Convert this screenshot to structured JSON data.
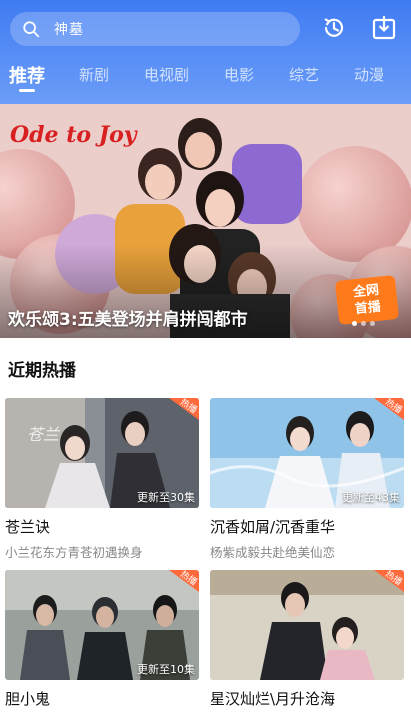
{
  "search": {
    "text": "神墓"
  },
  "tabs": [
    {
      "label": "推荐",
      "active": true
    },
    {
      "label": "新剧"
    },
    {
      "label": "电视剧"
    },
    {
      "label": "电影"
    },
    {
      "label": "综艺"
    },
    {
      "label": "动漫"
    }
  ],
  "header_icons": [
    "history-icon",
    "download-icon"
  ],
  "banner": {
    "logo_text": "Ode to Joy",
    "caption": "欢乐颂3:五美登场并肩拼闯都市",
    "badge_line1": "全网",
    "badge_line2": "首播"
  },
  "section": {
    "title": "近期热播"
  },
  "cards": [
    {
      "title": "苍兰诀",
      "subtitle": "小兰花东方青苍初遇换身",
      "update": "更新至30集",
      "hot": "热播"
    },
    {
      "title": "沉香如屑/沉香重华",
      "subtitle": "杨紫成毅共赴绝美仙恋",
      "update": "更新至43集",
      "hot": "热播"
    },
    {
      "title": "胆小鬼",
      "subtitle": "",
      "update": "更新至10集",
      "hot": "热播"
    },
    {
      "title": "星汉灿烂\\月升沧海",
      "subtitle": "",
      "update": "",
      "hot": "热播"
    }
  ],
  "colors": {
    "header": "#3f7bf2",
    "hot_tag": "#ff6a3d"
  }
}
